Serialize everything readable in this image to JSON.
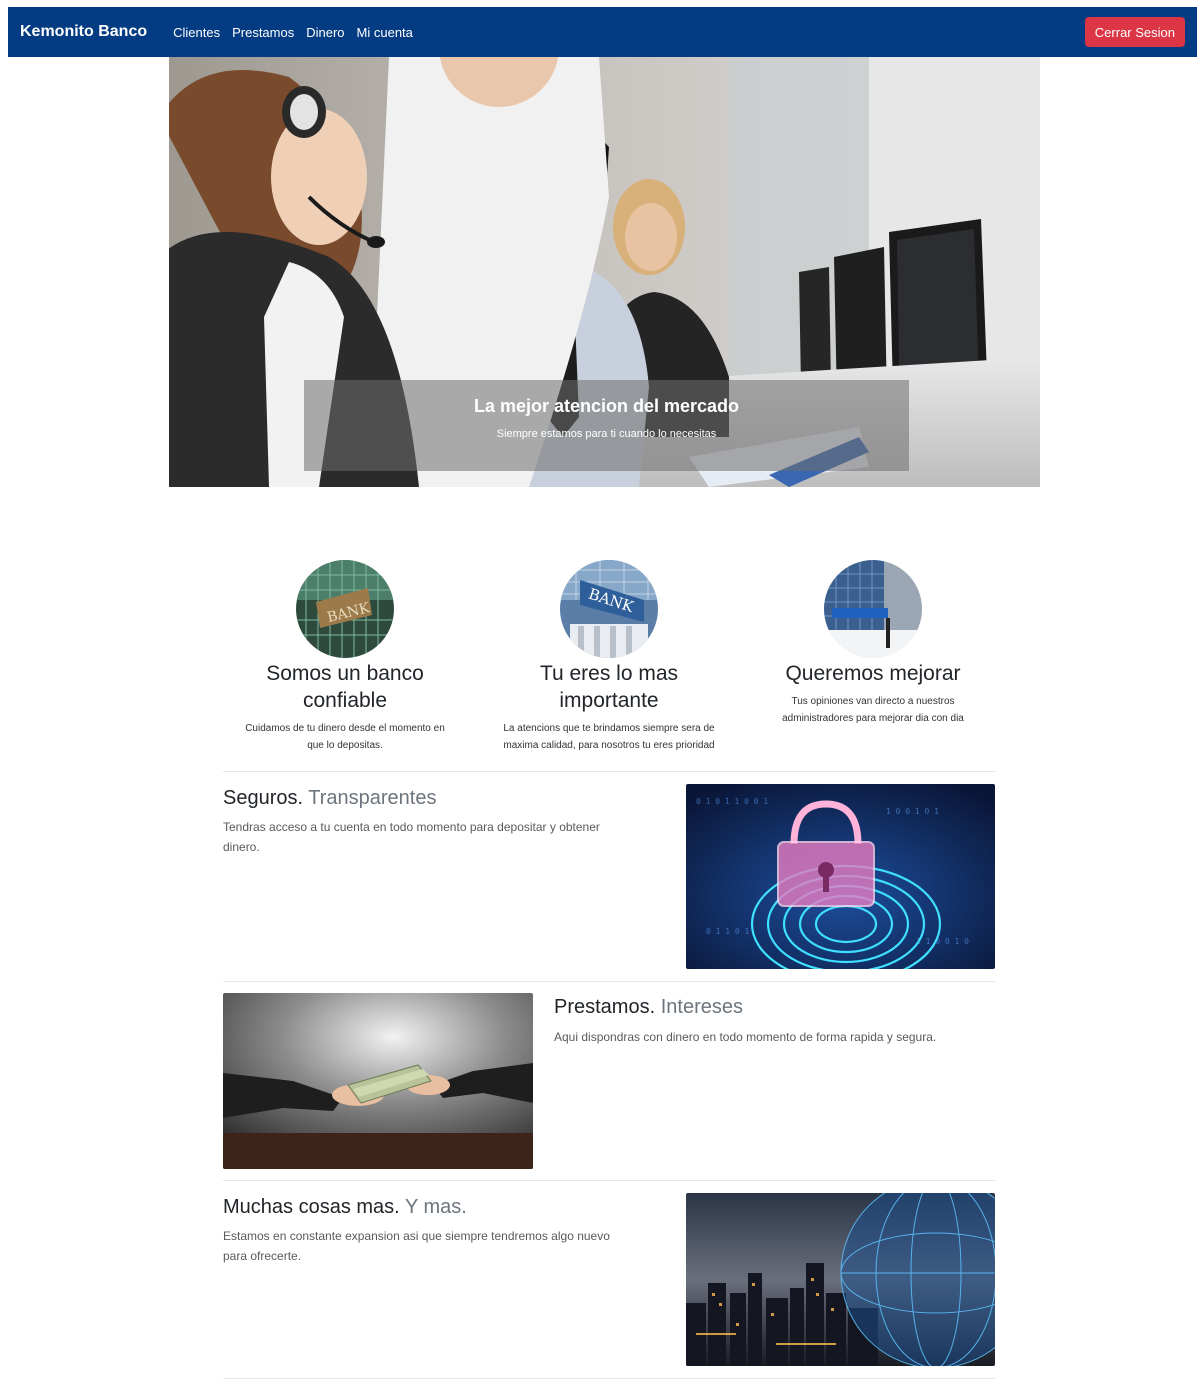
{
  "navbar": {
    "brand": "Kemonito Banco",
    "links": [
      "Clientes",
      "Prestamos",
      "Dinero",
      "Mi cuenta"
    ],
    "logout_label": "Cerrar Sesion",
    "bg_color": "#033c82",
    "logout_color": "#dc3545"
  },
  "hero": {
    "title": "La mejor atencion del mercado",
    "subtitle": "Siempre estamos para ti cuando lo necesitas"
  },
  "features": [
    {
      "title_line1": "Somos un banco",
      "title_line2": "confiable",
      "text_line1": "Cuidamos de tu dinero desde el momento en",
      "text_line2": "que lo depositas."
    },
    {
      "title_line1": "Tu eres lo mas",
      "title_line2": "importante",
      "text_line1": "La atencions que te brindamos siempre sera de",
      "text_line2": "maxima calidad, para nosotros tu eres prioridad"
    },
    {
      "title_line1": "Queremos mejorar",
      "title_line2": "",
      "text_line1": "Tus opiniones van directo a nuestros",
      "text_line2": "administradores para mejorar dia con dia"
    }
  ],
  "featurettes": [
    {
      "heading": "Seguros.",
      "muted": "Transparentes",
      "text_line1": "Tendras acceso a tu cuenta en todo momento para depositar y obtener",
      "text_line2": "dinero."
    },
    {
      "heading": "Prestamos.",
      "muted": "Intereses",
      "text_line1": "Aqui dispondras con dinero en todo momento de forma rapida y segura.",
      "text_line2": ""
    },
    {
      "heading": "Muchas cosas mas.",
      "muted": "Y mas.",
      "text_line1": "Estamos en constante expansion asi que siempre tendremos algo nuevo",
      "text_line2": "para ofrecerte."
    }
  ]
}
